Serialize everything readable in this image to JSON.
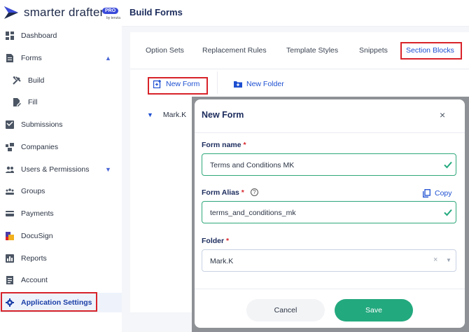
{
  "app": {
    "logo_text": "smarter drafter",
    "logo_badge": "PRO",
    "logo_byline": "by tenzia",
    "brand_color": "#1d4fd1",
    "accent_green": "#23a97e",
    "highlight_red": "#d8232a"
  },
  "header": {
    "title": "Build Forms"
  },
  "sidebar": {
    "items": [
      {
        "label": "Dashboard",
        "icon": "dashboard-icon"
      },
      {
        "label": "Forms",
        "icon": "document-icon",
        "expanded": true
      },
      {
        "label": "Build",
        "icon": "tools-icon"
      },
      {
        "label": "Fill",
        "icon": "edit-document-icon"
      },
      {
        "label": "Submissions",
        "icon": "inbox-icon"
      },
      {
        "label": "Companies",
        "icon": "companies-icon"
      },
      {
        "label": "Users & Permissions",
        "icon": "users-icon",
        "expanded": false
      },
      {
        "label": "Groups",
        "icon": "groups-icon"
      },
      {
        "label": "Payments",
        "icon": "payment-icon"
      },
      {
        "label": "DocuSign",
        "icon": "docusign-icon"
      },
      {
        "label": "Reports",
        "icon": "reports-icon"
      },
      {
        "label": "Account",
        "icon": "account-icon"
      },
      {
        "label": "Application Settings",
        "icon": "gear-icon",
        "active": true
      }
    ]
  },
  "tabs": [
    {
      "label": "Option Sets"
    },
    {
      "label": "Replacement Rules"
    },
    {
      "label": "Template Styles"
    },
    {
      "label": "Snippets"
    },
    {
      "label": "Section Blocks",
      "active": true
    }
  ],
  "toolbar": {
    "new_form_label": "New Form",
    "new_folder_label": "New Folder"
  },
  "tree": {
    "folder_label": "Mark.K"
  },
  "modal": {
    "title": "New Form",
    "close_symbol": "×",
    "form_name": {
      "label": "Form name",
      "required": "*",
      "value": "Terms and Conditions MK"
    },
    "form_alias": {
      "label": "Form Alias",
      "required": "*",
      "help": "?",
      "value": "terms_and_conditions_mk",
      "copy_label": "Copy"
    },
    "folder": {
      "label": "Folder",
      "required": "*",
      "value": "Mark.K",
      "clear_symbol": "×"
    },
    "cancel_label": "Cancel",
    "save_label": "Save"
  }
}
